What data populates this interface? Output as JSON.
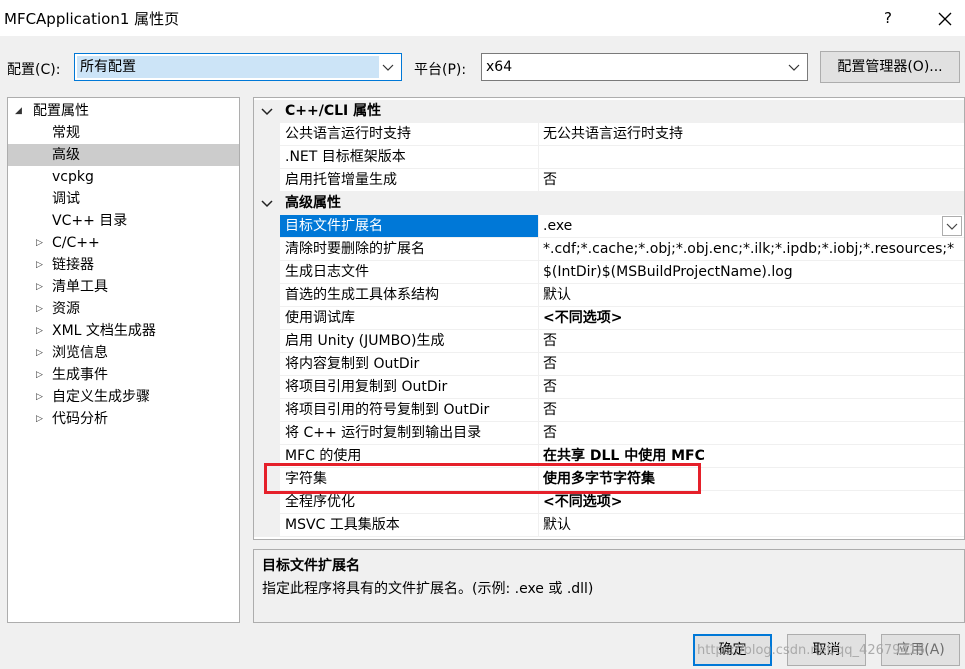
{
  "window": {
    "title": "MFCApplication1 属性页",
    "help": "?",
    "close_icon": "close-icon"
  },
  "config": {
    "label": "配置(C):",
    "value": "所有配置"
  },
  "platform": {
    "label": "平台(P):",
    "value": "x64"
  },
  "config_manager_button": "配置管理器(O)...",
  "tree": {
    "root": "配置属性",
    "items": [
      {
        "label": "常规",
        "expandable": false
      },
      {
        "label": "高级",
        "expandable": false,
        "selected": true
      },
      {
        "label": "vcpkg",
        "expandable": false
      },
      {
        "label": "调试",
        "expandable": false
      },
      {
        "label": "VC++ 目录",
        "expandable": false
      },
      {
        "label": "C/C++",
        "expandable": true
      },
      {
        "label": "链接器",
        "expandable": true
      },
      {
        "label": "清单工具",
        "expandable": true
      },
      {
        "label": "资源",
        "expandable": true
      },
      {
        "label": "XML 文档生成器",
        "expandable": true
      },
      {
        "label": "浏览信息",
        "expandable": true
      },
      {
        "label": "生成事件",
        "expandable": true
      },
      {
        "label": "自定义生成步骤",
        "expandable": true
      },
      {
        "label": "代码分析",
        "expandable": true
      }
    ]
  },
  "grid": {
    "categories": [
      {
        "label": "C++/CLI 属性",
        "rows": [
          {
            "name": "公共语言运行时支持",
            "value": "无公共语言运行时支持"
          },
          {
            "name": ".NET 目标框架版本",
            "value": ""
          },
          {
            "name": "启用托管增量生成",
            "value": "否"
          }
        ]
      },
      {
        "label": "高级属性",
        "rows": [
          {
            "name": "目标文件扩展名",
            "value": ".exe"
          },
          {
            "name": "清除时要删除的扩展名",
            "value": "*.cdf;*.cache;*.obj;*.obj.enc;*.ilk;*.ipdb;*.iobj;*.resources;*"
          },
          {
            "name": "生成日志文件",
            "value": "$(IntDir)$(MSBuildProjectName).log"
          },
          {
            "name": "首选的生成工具体系结构",
            "value": "默认"
          },
          {
            "name": "使用调试库",
            "value": "<不同选项>"
          },
          {
            "name": "启用 Unity (JUMBO)生成",
            "value": "否"
          },
          {
            "name": "将内容复制到 OutDir",
            "value": "否"
          },
          {
            "name": "将项目引用复制到 OutDir",
            "value": "否"
          },
          {
            "name": "将项目引用的符号复制到 OutDir",
            "value": "否"
          },
          {
            "name": "将 C++ 运行时复制到输出目录",
            "value": "否"
          },
          {
            "name": "MFC 的使用",
            "value": "在共享 DLL 中使用 MFC"
          },
          {
            "name": "字符集",
            "value": "使用多字节字符集"
          },
          {
            "name": "全程序优化",
            "value": "<不同选项>"
          },
          {
            "name": "MSVC 工具集版本",
            "value": "默认"
          }
        ]
      }
    ]
  },
  "description": {
    "title": "目标文件扩展名",
    "text": "指定此程序将具有的文件扩展名。(示例: .exe 或 .dll)"
  },
  "buttons": {
    "ok": "确定",
    "cancel": "取消",
    "apply": "应用(A)"
  },
  "watermark": "https://blog.csdn.net/qq_42679415",
  "colors": {
    "selection": "#0078d7",
    "highlight_box": "#e5202a"
  }
}
